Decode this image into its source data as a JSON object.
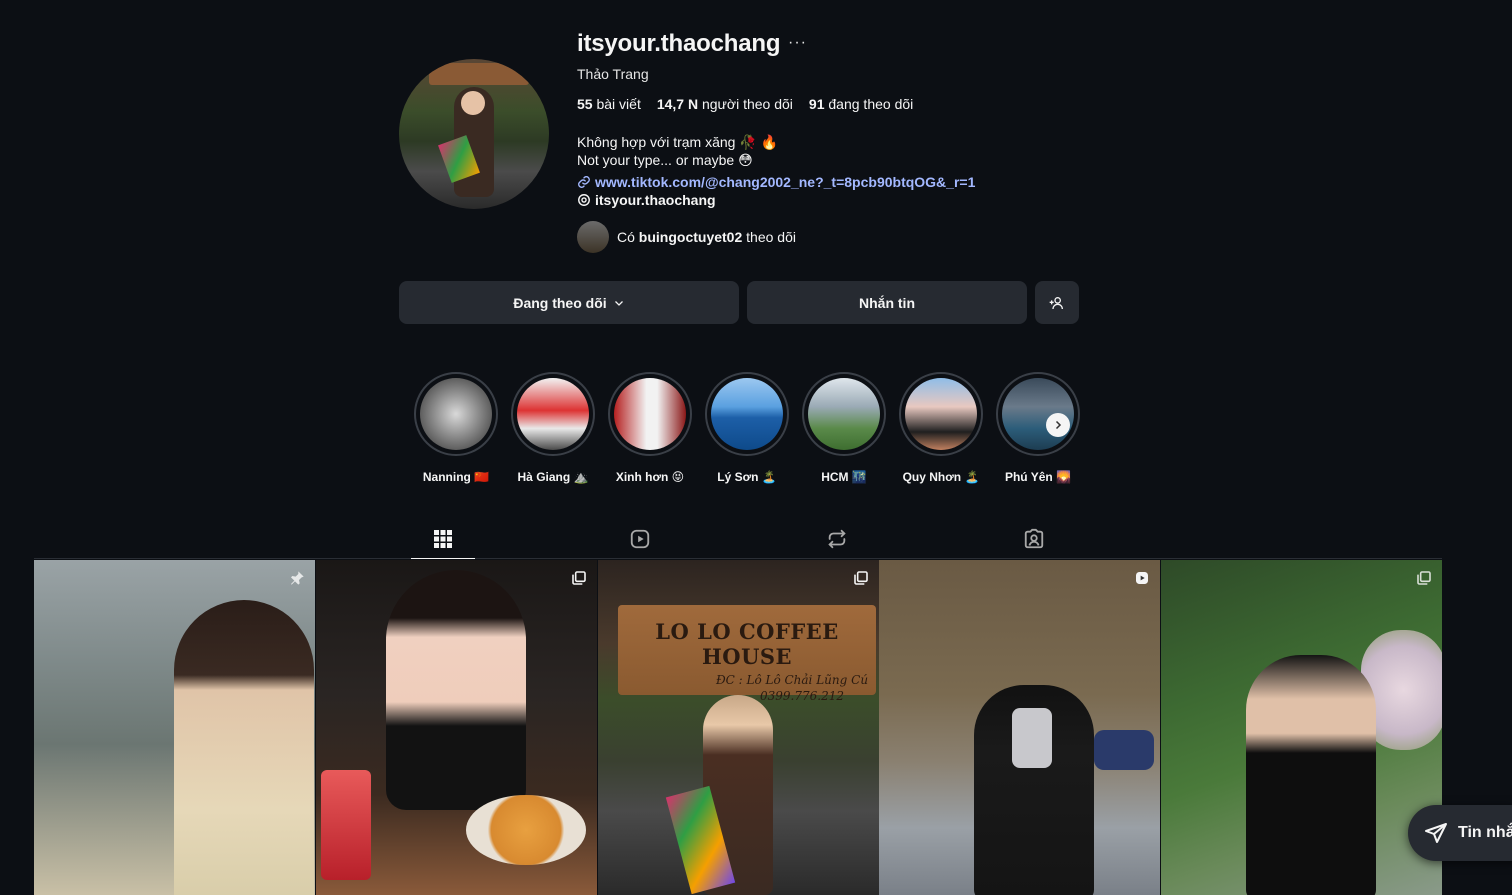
{
  "profile": {
    "username": "itsyour.thaochang",
    "more": "···",
    "full_name": "Thảo Trang",
    "stats": {
      "posts_count": "55",
      "posts_label": "bài viết",
      "followers_count": "14,7 N",
      "followers_label": "người theo dõi",
      "following_count": "91",
      "following_label": "đang theo dõi"
    },
    "bio_line1": "Không hợp với trạm xăng 🥀 🔥",
    "bio_line2": "Not your type... or maybe 😳",
    "link": "www.tiktok.com/@chang2002_ne?_t=8pcb90btqOG&_r=1",
    "threads_handle": "itsyour.thaochang",
    "followed_by_prefix": "Có",
    "followed_by_user": "buingoctuyet02",
    "followed_by_suffix": "theo dõi"
  },
  "actions": {
    "following_label": "Đang theo dõi",
    "message_label": "Nhắn tin"
  },
  "highlights": [
    {
      "label": "Nanning 🇨🇳"
    },
    {
      "label": "Hà Giang ⛰️"
    },
    {
      "label": "Xinh hơn 😝"
    },
    {
      "label": "Lý Sơn 🏝️"
    },
    {
      "label": "HCM 🌃"
    },
    {
      "label": "Quy Nhơn 🏝️"
    },
    {
      "label": "Phú Yên 🌄"
    }
  ],
  "tabs": [
    "grid-icon",
    "reels-icon",
    "reposts-icon",
    "tagged-icon"
  ],
  "posts": [
    {
      "badge": "pin-icon"
    },
    {
      "badge": "carousel-icon"
    },
    {
      "badge": "carousel-icon",
      "sign_text": "LO LO COFFEE HOUSE",
      "sign_sub": "ĐC : Lô Lô Chải Lũng Cú",
      "sign_phone": "0399.776.212"
    },
    {
      "badge": "reel-icon"
    },
    {
      "badge": "carousel-icon"
    }
  ],
  "dm": {
    "label": "Tin nhắ"
  },
  "colors": {
    "background": "#0c0f14",
    "button": "#262a31",
    "link": "#a3b8ff"
  }
}
